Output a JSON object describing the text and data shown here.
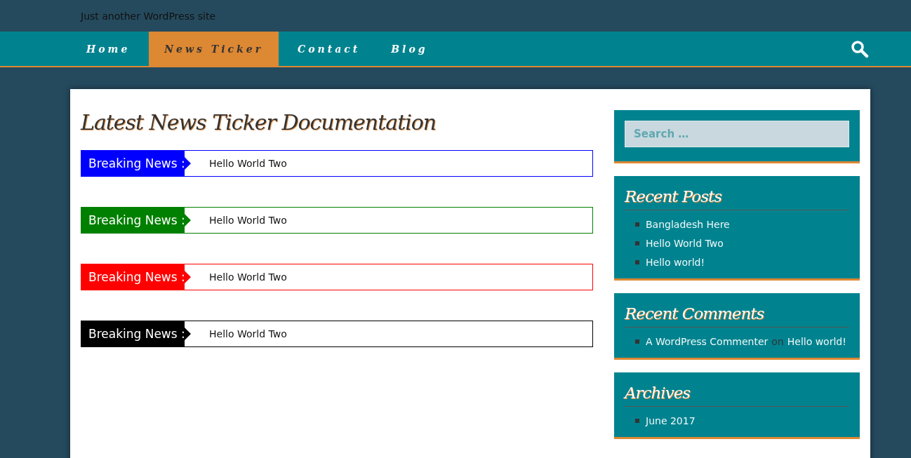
{
  "site": {
    "tagline": "Just another WordPress site"
  },
  "nav": {
    "items": [
      {
        "label": "Home",
        "selected": false
      },
      {
        "label": "News Ticker",
        "selected": true
      },
      {
        "label": "Contact",
        "selected": false
      },
      {
        "label": "Blog",
        "selected": false
      }
    ]
  },
  "page": {
    "title": "Latest News Ticker Documentation",
    "tickers": [
      {
        "label": "Breaking News :",
        "text": "Hello World Two",
        "color": "#0000ff"
      },
      {
        "label": "Breaking News :",
        "text": "Hello World Two",
        "color": "#008000"
      },
      {
        "label": "Breaking News :",
        "text": "Hello World Two",
        "color": "#ff0000"
      },
      {
        "label": "Breaking News :",
        "text": "Hello World Two",
        "color": "#000000"
      }
    ]
  },
  "sidebar": {
    "search": {
      "placeholder": "Search …"
    },
    "recent_posts": {
      "title": "Recent Posts",
      "items": [
        "Bangladesh Here",
        "Hello World Two",
        "Hello world!"
      ]
    },
    "recent_comments": {
      "title": "Recent Comments",
      "items": [
        {
          "author": "A WordPress Commenter",
          "on": "on",
          "post": "Hello world!"
        }
      ]
    },
    "archives": {
      "title": "Archives",
      "items": [
        "June 2017"
      ]
    }
  }
}
